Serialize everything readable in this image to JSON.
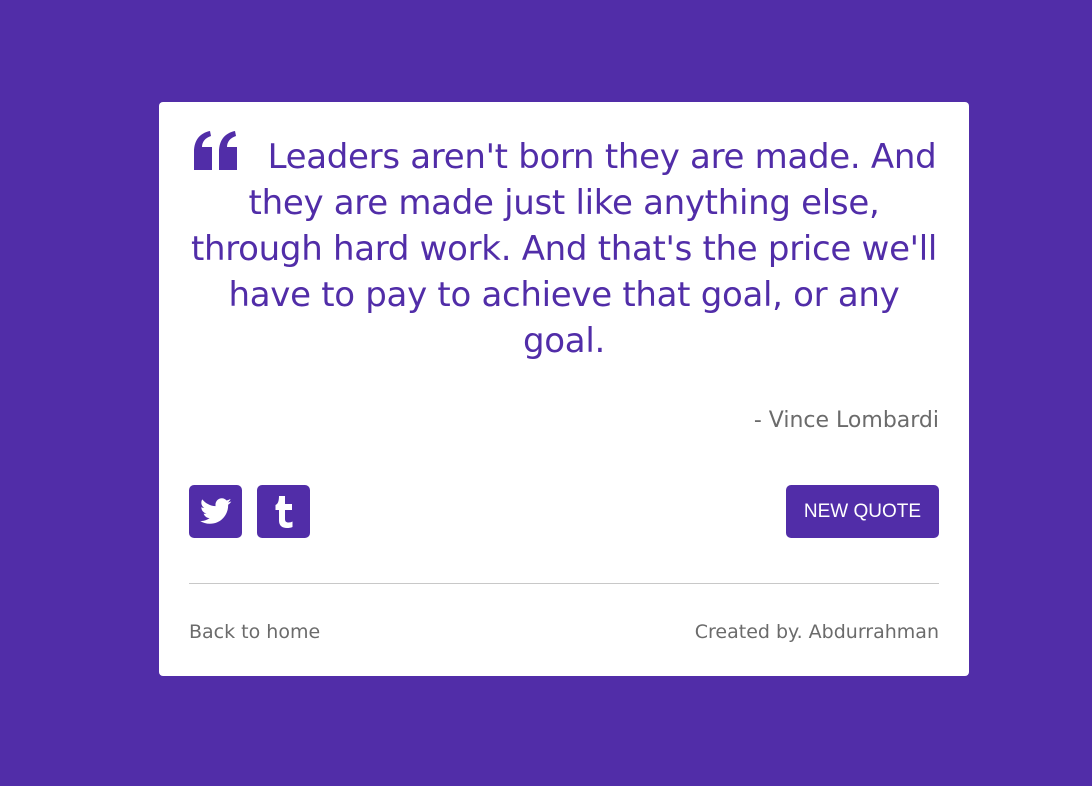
{
  "colors": {
    "accent": "#512da8",
    "background": "#512da8",
    "card": "#ffffff",
    "muted_text": "#6b6b6b"
  },
  "quote": {
    "icon": "quote-left-icon",
    "text": "Leaders aren't born they are made. And they are made just like anything else, through hard work. And that's the price we'll have to pay to achieve that goal, or any goal.",
    "author": "- Vince Lombardi"
  },
  "actions": {
    "twitter_icon": "twitter-icon",
    "tumblr_icon": "tumblr-icon",
    "new_quote_label": "NEW QUOTE"
  },
  "footer": {
    "back_link": "Back to home",
    "credit": "Created by. Abdurrahman"
  }
}
